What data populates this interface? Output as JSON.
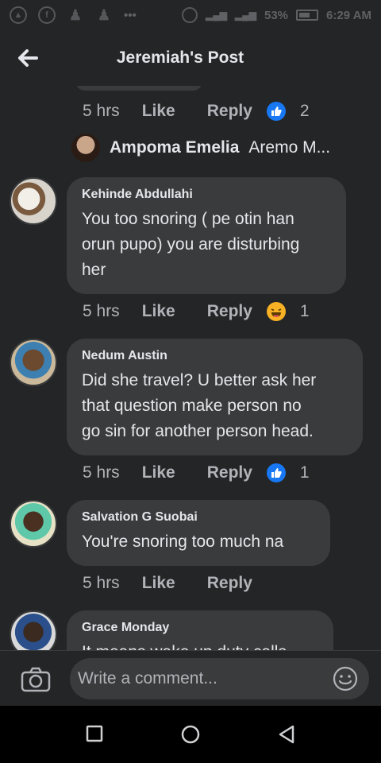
{
  "status_bar": {
    "battery": "53%",
    "time": "6:29 AM"
  },
  "header": {
    "title": "Jeremiah's Post"
  },
  "top_thread": {
    "time": "5 hrs",
    "like": "Like",
    "reply": "Reply",
    "reaction_count": "2",
    "reply_preview": {
      "name": "Ampoma Emelia",
      "text": "Aremo M..."
    }
  },
  "comments": [
    {
      "name": "Kehinde Abdullahi",
      "text_lines": [
        "You too snoring ( pe otin han",
        "orun pupo) you are disturbing",
        "her"
      ],
      "time": "5 hrs",
      "like": "Like",
      "reply": "Reply",
      "reaction": "haha",
      "reaction_count": "1"
    },
    {
      "name": "Nedum Austin",
      "text_lines": [
        "Did she travel? U better ask her",
        "that question make person no",
        "go sin for another person head."
      ],
      "time": "5 hrs",
      "like": "Like",
      "reply": "Reply",
      "reaction": "like",
      "reaction_count": "1"
    },
    {
      "name": "Salvation G Suobai",
      "text_lines": [
        "You're snoring too much na"
      ],
      "time": "5 hrs",
      "like": "Like",
      "reply": "Reply"
    },
    {
      "name": "Grace Monday",
      "text_lines": [
        "It means wake up duty calls"
      ]
    }
  ],
  "composer": {
    "placeholder": "Write a comment..."
  },
  "colors": {
    "background": "#242526",
    "bubble": "#3a3b3c",
    "text": "#e4e6eb",
    "muted": "#b0b3b8",
    "like_blue": "#1877f2"
  }
}
